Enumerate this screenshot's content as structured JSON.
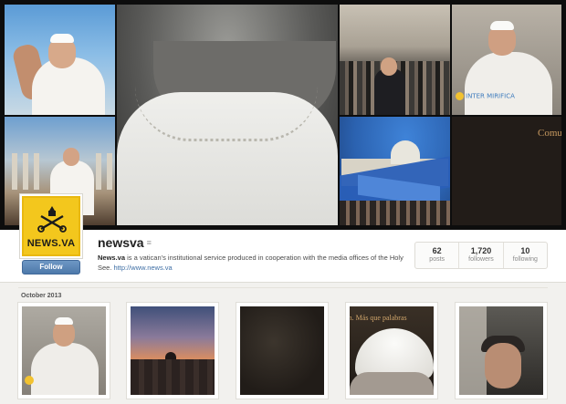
{
  "profile": {
    "avatar_text": "NEWS.VA",
    "follow_label": "Follow",
    "username": "newsva",
    "menu_glyph": "≡",
    "bio_name": "News.va",
    "bio_text": " is a vatican's institutional service produced in cooperation with the media offices of the Holy See. ",
    "bio_link": "http://www.news.va"
  },
  "stats": [
    {
      "num": "62",
      "label": "posts"
    },
    {
      "num": "1,720",
      "label": "followers"
    },
    {
      "num": "10",
      "label": "following"
    }
  ],
  "header_tiles": {
    "watermark": "INTER MIRIFICA",
    "overlay_text": "Comu"
  },
  "feed": {
    "month_label": "October 2013",
    "overlay_text": "Comunicación. Más que palabras"
  },
  "colors": {
    "accent": "#4d79aa",
    "brand_yellow": "#f3c71d",
    "link": "#3f6fa5"
  }
}
